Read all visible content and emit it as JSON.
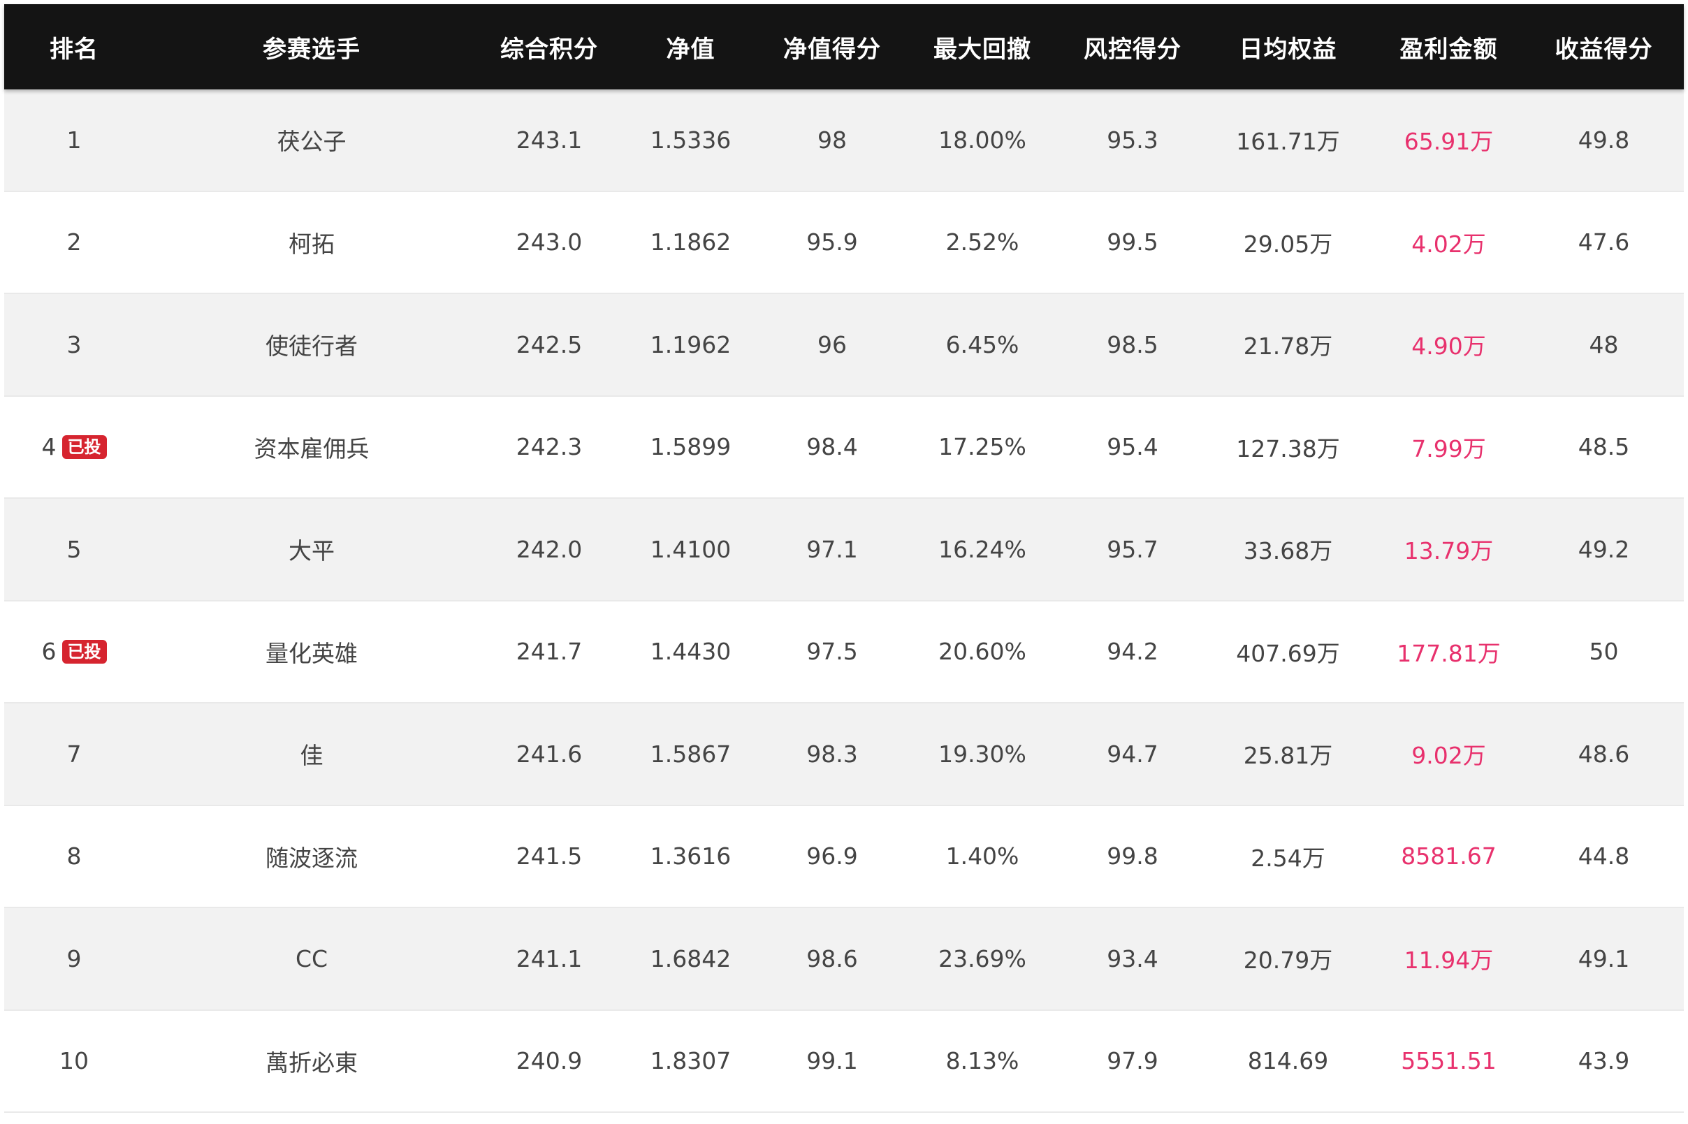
{
  "headers": {
    "rank": "排名",
    "player": "参赛选手",
    "score": "综合积分",
    "nav": "净值",
    "nav_score": "净值得分",
    "max_drawdown": "最大回撤",
    "risk_score": "风控得分",
    "daily_equity": "日均权益",
    "profit": "盈利金额",
    "return_score": "收益得分"
  },
  "colors": {
    "header_bg": "#141414",
    "profit_text": "#e8316d",
    "badge_bg": "#d6242f",
    "row_alt": "#f2f2f2"
  },
  "badge_label": "已投",
  "rows": [
    {
      "rank": "1",
      "badge": false,
      "player": "茯公子",
      "score": "243.1",
      "nav": "1.5336",
      "nav_score": "98",
      "max_drawdown": "18.00%",
      "risk_score": "95.3",
      "daily_equity": "161.71万",
      "profit": "65.91万",
      "return_score": "49.8"
    },
    {
      "rank": "2",
      "badge": false,
      "player": "柯拓",
      "score": "243.0",
      "nav": "1.1862",
      "nav_score": "95.9",
      "max_drawdown": "2.52%",
      "risk_score": "99.5",
      "daily_equity": "29.05万",
      "profit": "4.02万",
      "return_score": "47.6"
    },
    {
      "rank": "3",
      "badge": false,
      "player": "使徒行者",
      "score": "242.5",
      "nav": "1.1962",
      "nav_score": "96",
      "max_drawdown": "6.45%",
      "risk_score": "98.5",
      "daily_equity": "21.78万",
      "profit": "4.90万",
      "return_score": "48"
    },
    {
      "rank": "4",
      "badge": true,
      "player": "资本雇佣兵",
      "score": "242.3",
      "nav": "1.5899",
      "nav_score": "98.4",
      "max_drawdown": "17.25%",
      "risk_score": "95.4",
      "daily_equity": "127.38万",
      "profit": "7.99万",
      "return_score": "48.5"
    },
    {
      "rank": "5",
      "badge": false,
      "player": "大平",
      "score": "242.0",
      "nav": "1.4100",
      "nav_score": "97.1",
      "max_drawdown": "16.24%",
      "risk_score": "95.7",
      "daily_equity": "33.68万",
      "profit": "13.79万",
      "return_score": "49.2"
    },
    {
      "rank": "6",
      "badge": true,
      "player": "量化英雄",
      "score": "241.7",
      "nav": "1.4430",
      "nav_score": "97.5",
      "max_drawdown": "20.60%",
      "risk_score": "94.2",
      "daily_equity": "407.69万",
      "profit": "177.81万",
      "return_score": "50"
    },
    {
      "rank": "7",
      "badge": false,
      "player": "佳",
      "score": "241.6",
      "nav": "1.5867",
      "nav_score": "98.3",
      "max_drawdown": "19.30%",
      "risk_score": "94.7",
      "daily_equity": "25.81万",
      "profit": "9.02万",
      "return_score": "48.6"
    },
    {
      "rank": "8",
      "badge": false,
      "player": "随波逐流",
      "score": "241.5",
      "nav": "1.3616",
      "nav_score": "96.9",
      "max_drawdown": "1.40%",
      "risk_score": "99.8",
      "daily_equity": "2.54万",
      "profit": "8581.67",
      "return_score": "44.8"
    },
    {
      "rank": "9",
      "badge": false,
      "player": "CC",
      "score": "241.1",
      "nav": "1.6842",
      "nav_score": "98.6",
      "max_drawdown": "23.69%",
      "risk_score": "93.4",
      "daily_equity": "20.79万",
      "profit": "11.94万",
      "return_score": "49.1"
    },
    {
      "rank": "10",
      "badge": false,
      "player": "萬折必東",
      "score": "240.9",
      "nav": "1.8307",
      "nav_score": "99.1",
      "max_drawdown": "8.13%",
      "risk_score": "97.9",
      "daily_equity": "814.69",
      "profit": "5551.51",
      "return_score": "43.9"
    }
  ]
}
